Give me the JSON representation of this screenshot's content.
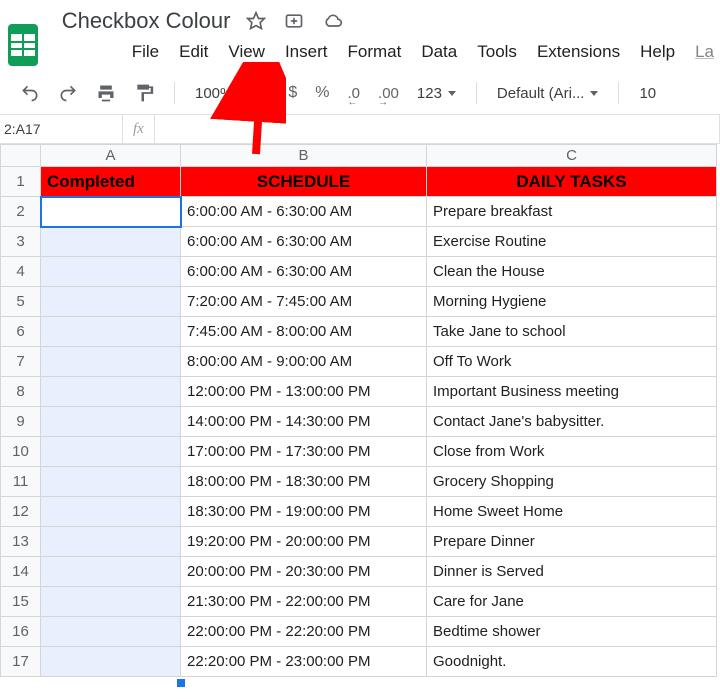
{
  "doc_title": "Checkbox Colour",
  "menus": [
    "File",
    "Edit",
    "View",
    "Insert",
    "Format",
    "Data",
    "Tools",
    "Extensions",
    "Help"
  ],
  "menu_tail": "La",
  "toolbar": {
    "zoom": "100%",
    "currency": "$",
    "percent": "%",
    "dec_dec": ".0",
    "inc_dec": ".00",
    "numfmt": "123",
    "font": "Default (Ari...",
    "fontsize": "10"
  },
  "namebox": "2:A17",
  "fx": "fx",
  "columns": [
    "A",
    "B",
    "C"
  ],
  "header_row": {
    "a": "Completed",
    "b": "SCHEDULE",
    "c": "DAILY TASKS"
  },
  "rows": [
    {
      "n": "2",
      "b": "6:00:00 AM - 6:30:00 AM",
      "c": "Prepare breakfast"
    },
    {
      "n": "3",
      "b": "6:00:00 AM - 6:30:00 AM",
      "c": "Exercise Routine"
    },
    {
      "n": "4",
      "b": "6:00:00 AM - 6:30:00 AM",
      "c": "Clean the House"
    },
    {
      "n": "5",
      "b": "7:20:00 AM - 7:45:00 AM",
      "c": "Morning Hygiene"
    },
    {
      "n": "6",
      "b": "7:45:00 AM - 8:00:00 AM",
      "c": "Take Jane to school"
    },
    {
      "n": "7",
      "b": "8:00:00 AM - 9:00:00 AM",
      "c": "Off To Work"
    },
    {
      "n": "8",
      "b": "12:00:00 PM - 13:00:00 PM",
      "c": "Important Business meeting"
    },
    {
      "n": "9",
      "b": "14:00:00 PM - 14:30:00 PM",
      "c": "Contact Jane's babysitter."
    },
    {
      "n": "10",
      "b": "17:00:00 PM - 17:30:00 PM",
      "c": "Close from Work"
    },
    {
      "n": "11",
      "b": "18:00:00 PM - 18:30:00 PM",
      "c": "Grocery Shopping"
    },
    {
      "n": "12",
      "b": "18:30:00 PM - 19:00:00 PM",
      "c": "Home Sweet Home"
    },
    {
      "n": "13",
      "b": "19:20:00 PM - 20:00:00 PM",
      "c": "Prepare Dinner"
    },
    {
      "n": "14",
      "b": "20:00:00 PM - 20:30:00 PM",
      "c": "Dinner is Served"
    },
    {
      "n": "15",
      "b": "21:30:00 PM - 22:00:00 PM",
      "c": "Care for Jane"
    },
    {
      "n": "16",
      "b": "22:00:00 PM - 22:20:00 PM",
      "c": "Bedtime shower"
    },
    {
      "n": "17",
      "b": "22:20:00 PM - 23:00:00 PM",
      "c": "Goodnight."
    }
  ]
}
